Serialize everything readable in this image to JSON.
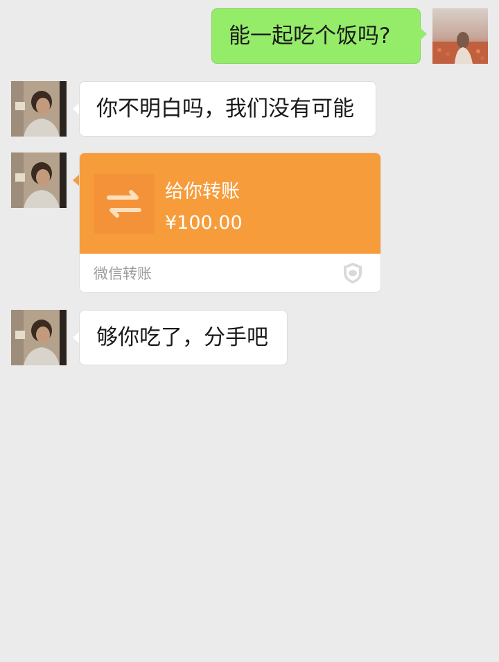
{
  "messages": [
    {
      "sender": "me",
      "text": "能一起吃个饭吗?"
    },
    {
      "sender": "them",
      "text": "你不明白吗，我们没有可能"
    },
    {
      "sender": "them",
      "type": "transfer",
      "title": "给你转账",
      "amount": "¥100.00",
      "label": "微信转账"
    },
    {
      "sender": "them",
      "text": "够你吃了，分手吧"
    }
  ],
  "colors": {
    "background": "#ebebeb",
    "my_bubble": "#95ec69",
    "their_bubble": "#ffffff",
    "transfer_orange": "#f79c3b"
  },
  "icons": {
    "transfer": "transfer-arrows-icon",
    "security": "shield-icon"
  }
}
